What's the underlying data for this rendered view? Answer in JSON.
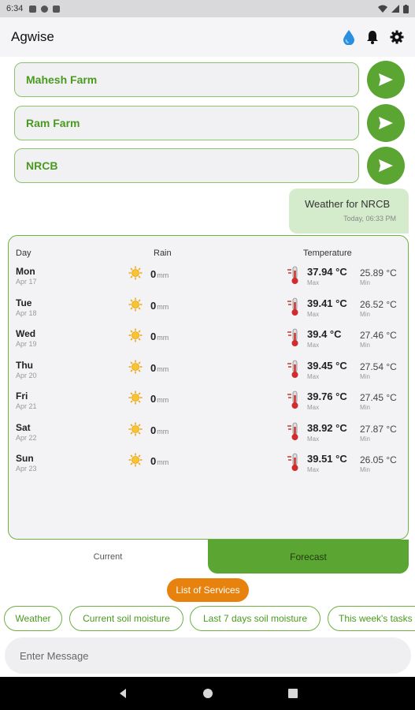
{
  "status_bar": {
    "time": "6:34"
  },
  "app_bar": {
    "title": "Agwise",
    "icons": [
      "water-drop-icon",
      "bell-icon",
      "gear-icon"
    ]
  },
  "farms": [
    {
      "name": "Mahesh Farm"
    },
    {
      "name": "Ram Farm"
    },
    {
      "name": "NRCB"
    }
  ],
  "chat_bubble": {
    "message": "Weather for NRCB",
    "timestamp": "Today, 06:33 PM"
  },
  "weather": {
    "headers": {
      "day": "Day",
      "rain": "Rain",
      "temperature": "Temperature"
    },
    "rain_unit": "mm",
    "max_label": "Max",
    "min_label": "Min",
    "rows": [
      {
        "day": "Mon",
        "date": "Apr 17",
        "rain": "0",
        "max": "37.94 °C",
        "min": "25.89 °C"
      },
      {
        "day": "Tue",
        "date": "Apr 18",
        "rain": "0",
        "max": "39.41 °C",
        "min": "26.52 °C"
      },
      {
        "day": "Wed",
        "date": "Apr 19",
        "rain": "0",
        "max": "39.4 °C",
        "min": "27.46 °C"
      },
      {
        "day": "Thu",
        "date": "Apr 20",
        "rain": "0",
        "max": "39.45 °C",
        "min": "27.54 °C"
      },
      {
        "day": "Fri",
        "date": "Apr 21",
        "rain": "0",
        "max": "39.76 °C",
        "min": "27.45 °C"
      },
      {
        "day": "Sat",
        "date": "Apr 22",
        "rain": "0",
        "max": "38.92 °C",
        "min": "27.87 °C"
      },
      {
        "day": "Sun",
        "date": "Apr 23",
        "rain": "0",
        "max": "39.51 °C",
        "min": "26.05 °C"
      }
    ]
  },
  "tabs": {
    "current": "Current",
    "forecast": "Forecast"
  },
  "services_button": "List of Services",
  "chips": [
    "Weather",
    "Current soil moisture",
    "Last 7 days soil moisture",
    "This week's tasks"
  ],
  "input": {
    "placeholder": "Enter Message"
  },
  "colors": {
    "accent": "#5ba532",
    "orange": "#e8820f",
    "bubble": "#d4eccb"
  }
}
